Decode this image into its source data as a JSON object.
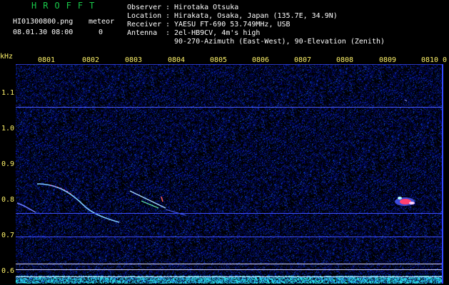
{
  "brand": "HROFFT",
  "file_name": "HI01300800.png",
  "datetime": "08.01.30 08:00",
  "meteor": {
    "label": "meteor",
    "count": "0"
  },
  "meta": {
    "observer_key": "Observer",
    "observer_val": "Hirotaka Otsuka",
    "location_key": "Location",
    "location_val": "Hirakata, Osaka, Japan (135.7E, 34.9N)",
    "receiver_key": "Receiver",
    "receiver_val": "YAESU FT-690 53.749MHz, USB",
    "antenna_key": "Antenna",
    "antenna_val1": "2el-HB9CV, 4m's high",
    "antenna_val2": "90-270-Azimuth (East-West), 90-Elevation (Zenith)"
  },
  "axis": {
    "y_unit": "kHz",
    "x_ticks": [
      "0801",
      "0802",
      "0803",
      "0804",
      "0805",
      "0806",
      "0807",
      "0808",
      "0809",
      "0810",
      "0"
    ],
    "y_ticks": [
      "1.1",
      "1.0",
      "0.9",
      "0.8",
      "0.7",
      "0.6"
    ]
  },
  "colors": {
    "text": "#ffffff",
    "accent": "#fff36a",
    "brand": "#19c94a",
    "background": "#020016"
  }
}
